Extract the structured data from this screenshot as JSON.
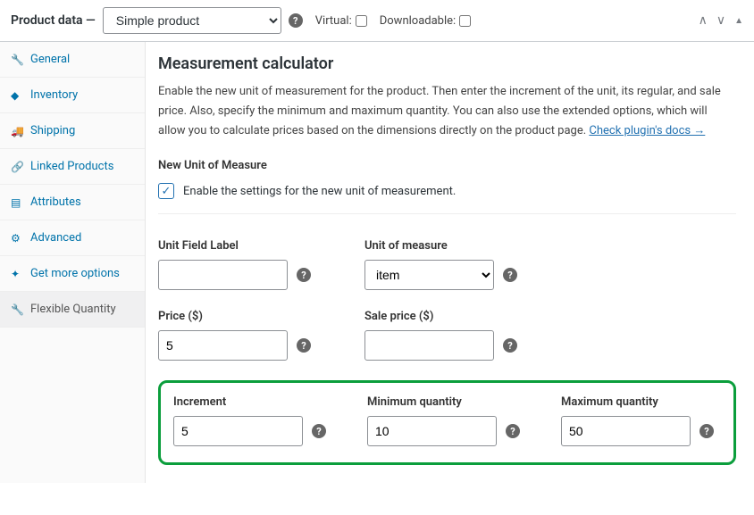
{
  "header": {
    "title": "Product data —",
    "product_type": "Simple product",
    "virtual_label": "Virtual:",
    "downloadable_label": "Downloadable:"
  },
  "tabs": [
    {
      "icon": "🔧",
      "label": "General"
    },
    {
      "icon": "◆",
      "label": "Inventory"
    },
    {
      "icon": "🚚",
      "label": "Shipping"
    },
    {
      "icon": "🔗",
      "label": "Linked Products"
    },
    {
      "icon": "▤",
      "label": "Attributes"
    },
    {
      "icon": "⚙",
      "label": "Advanced"
    },
    {
      "icon": "✦",
      "label": "Get more options"
    },
    {
      "icon": "🔧",
      "label": "Flexible Quantity"
    }
  ],
  "section": {
    "title": "Measurement calculator",
    "desc_a": "Enable the new unit of measurement for the product. Then enter the increment of the unit, its regular, and sale price. Also, specify the minimum and maximum quantity. You can also use the extended options, which will allow you to calculate prices based on the dimensions directly on the product page. ",
    "docs_link": "Check plugin's docs →",
    "unit_title": "New Unit of Measure",
    "enable_label": "Enable the settings for the new unit of measurement."
  },
  "fields": {
    "unit_field_label": {
      "label": "Unit Field Label",
      "value": ""
    },
    "unit_of_measure": {
      "label": "Unit of measure",
      "value": "item"
    },
    "price": {
      "label": "Price ($)",
      "value": "5"
    },
    "sale_price": {
      "label": "Sale price ($)",
      "value": ""
    },
    "increment": {
      "label": "Increment",
      "value": "5"
    },
    "min_qty": {
      "label": "Minimum quantity",
      "value": "10"
    },
    "max_qty": {
      "label": "Maximum quantity",
      "value": "50"
    }
  }
}
